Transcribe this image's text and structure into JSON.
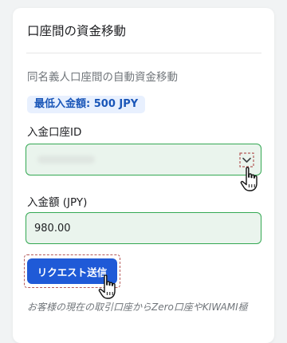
{
  "panel": {
    "title": "口座間の資金移動",
    "subtitle": "同名義人口座間の自動資金移動",
    "min_deposit_badge": "最低入金額: 500 JPY"
  },
  "form": {
    "account_label": "入金口座ID",
    "amount_label": "入金額 (JPY)",
    "amount_value": "980.00",
    "submit_label": "リクエスト送信"
  },
  "footnote": "お客様の現在の取引口座からZero口座やKIWAMI極",
  "colors": {
    "accent": "#1f5ad7",
    "field_border": "#34a853",
    "field_bg": "#eaf4ed",
    "badge_bg": "#e8f0fe",
    "badge_text": "#1a56b8"
  },
  "icons": {
    "dropdown": "chevron-down-icon",
    "cursor": "hand-pointer-icon"
  }
}
